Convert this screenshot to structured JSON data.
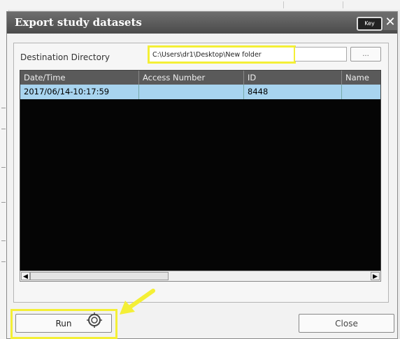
{
  "dialog": {
    "title": "Export study datasets",
    "key_label": "Key",
    "close_x": "✕"
  },
  "destination": {
    "label": "Destination Directory",
    "value": "C:\\Users\\dr1\\Desktop\\New folder",
    "browse_label": "..."
  },
  "table": {
    "columns": [
      "Date/Time",
      "Access Number",
      "ID",
      "Name"
    ],
    "rows": [
      [
        "2017/06/14-10:17:59",
        "",
        "8448",
        ""
      ]
    ]
  },
  "buttons": {
    "run": "Run",
    "close": "Close"
  },
  "colors": {
    "highlight": "#f4ef36",
    "selected_row": "#a8d4ef",
    "table_bg": "#050505"
  },
  "icons": {
    "cursor": "busy-cursor-icon",
    "annotation": "arrow-annotation-icon"
  }
}
